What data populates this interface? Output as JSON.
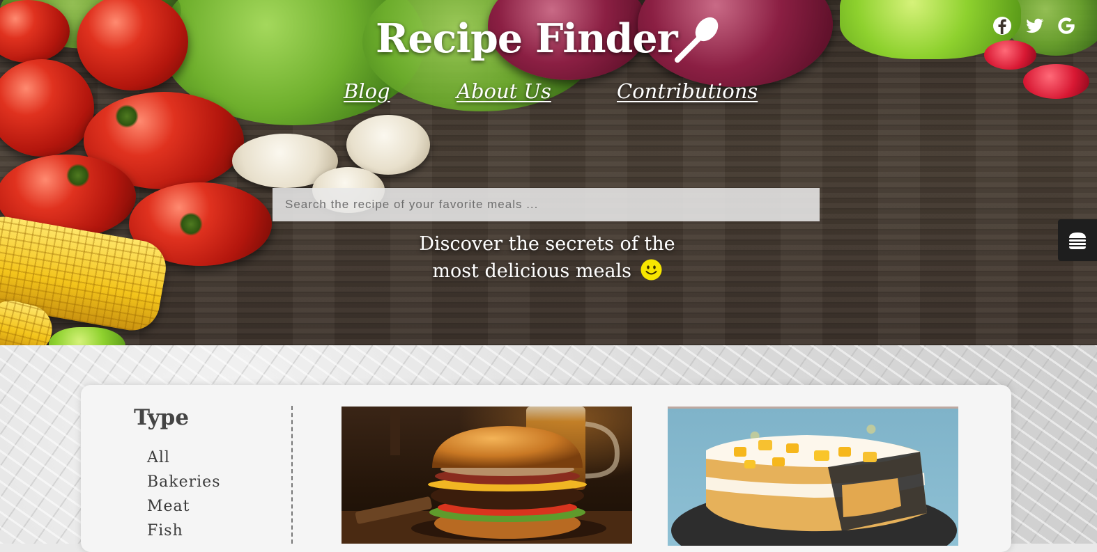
{
  "header": {
    "brand": "Recipe Finder",
    "nav": [
      {
        "label": "Blog"
      },
      {
        "label": "About Us"
      },
      {
        "label": "Contributions"
      }
    ],
    "social": [
      "facebook-icon",
      "twitter-icon",
      "google-icon"
    ]
  },
  "search": {
    "placeholder": "Search the recipe of your favorite meals ...",
    "value": ""
  },
  "tagline": {
    "line1": "Discover the secrets of the",
    "line2": "most delicious meals"
  },
  "filters": {
    "title": "Type",
    "items": [
      "All",
      "Bakeries",
      "Meat",
      "Fish"
    ]
  },
  "cards": [
    {
      "image": "burger-photo"
    },
    {
      "image": "cake-photo"
    }
  ],
  "colors": {
    "hero_text": "#ffffff",
    "panel_bg": "#f5f5f5",
    "smiley": "#f7e600",
    "side_tab": "#1e1e1e"
  }
}
